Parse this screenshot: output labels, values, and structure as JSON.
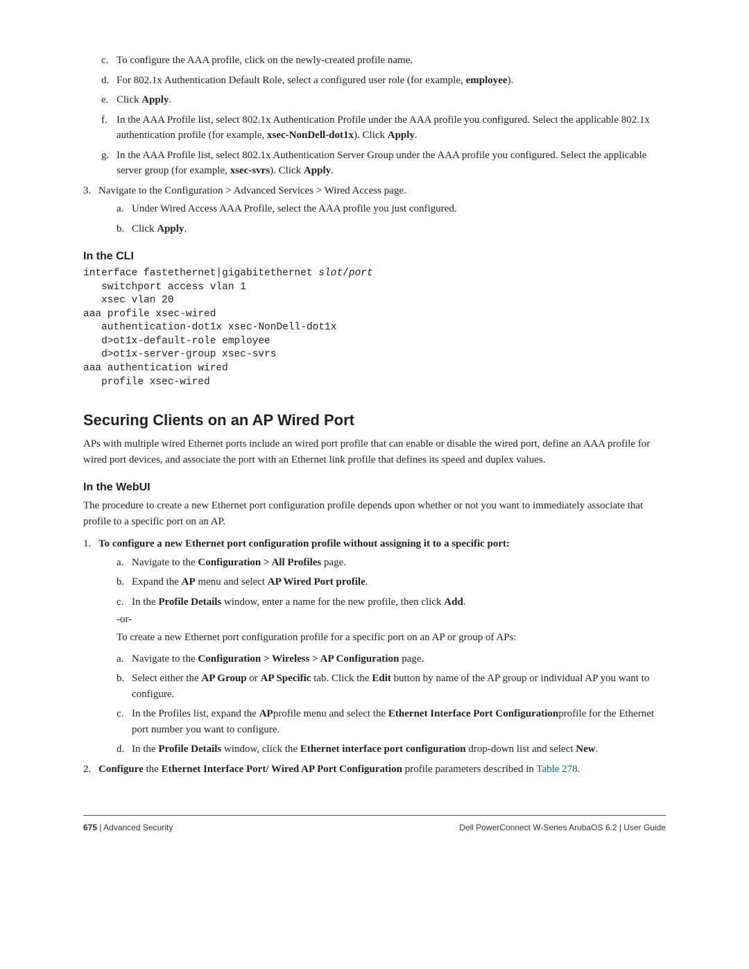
{
  "top_sub": {
    "c": "To configure the AAA profile, click on the newly-created profile name.",
    "d_pre": "For 802.1x Authentication Default Role, select a configured user role (for example, ",
    "d_bold": "employee",
    "d_post": ").",
    "e_pre": "Click ",
    "e_bold": "Apply",
    "e_post": ".",
    "f_pre": "In the AAA Profile list, select 802.1x Authentication Profile under the AAA profile you configured. Select the applicable 802.1x authentication profile (for example, ",
    "f_bold1": "xsec-NonDell-dot1x",
    "f_mid": "). Click ",
    "f_bold2": "Apply",
    "f_post": ".",
    "g_pre": "In the AAA Profile list, select 802.1x Authentication Server Group under the AAA profile you configured. Select the applicable server group (for example, ",
    "g_bold1": "xsec-svrs",
    "g_mid": "). Click ",
    "g_bold2": "Apply",
    "g_post": "."
  },
  "step3": {
    "text": "Navigate to the Configuration > Advanced Services > Wired Access page.",
    "a": "Under Wired Access AAA Profile, select the AAA profile you just configured.",
    "b_pre": "Click ",
    "b_bold": "Apply",
    "b_post": "."
  },
  "cli_heading": "In the CLI",
  "cli_code": {
    "l1a": "interface fastethernet|gigabitethernet ",
    "l1b": "slot",
    "l1c": "/",
    "l1d": "port",
    "l2": "   switchport access vlan 1",
    "l3": "   xsec vlan 20",
    "l4": "aaa profile xsec-wired",
    "l5": "   authentication-dot1x xsec-NonDell-dot1x",
    "l6": "   d>ot1x-default-role employee",
    "l7": "   d>ot1x-server-group xsec-svrs",
    "l8": "aaa authentication wired",
    "l9": "   profile xsec-wired"
  },
  "h2": "Securing Clients on an AP Wired Port",
  "h2_para": "APs with multiple wired Ethernet ports include an wired port profile that can enable or disable the wired port, define an AAA profile for wired port devices, and associate the port with an Ethernet link profile that defines its speed and duplex values.",
  "webui_heading": "In the WebUI",
  "webui_para": "The procedure to create a new Ethernet port configuration profile depends upon whether or not you want to immediately associate that profile to a specific port on an AP.",
  "step1": {
    "lead": "To configure a new Ethernet port configuration profile without assigning it to a specific port:",
    "a_pre": "Navigate to the ",
    "a_bold": "Configuration > All Profiles",
    "a_post": " page.",
    "b_pre": "Expand the ",
    "b_bold1": "AP",
    "b_mid": " menu and select ",
    "b_bold2": "AP Wired Port profile",
    "b_post": ".",
    "c_pre": "In the ",
    "c_bold1": "Profile Details",
    "c_mid": " window, enter a name for the new profile, then click ",
    "c_bold2": "Add",
    "c_post": "."
  },
  "or": "-or-",
  "alt_intro": "To create a new Ethernet port configuration profile for a specific port on an AP or group of APs:",
  "alt": {
    "a_pre": "Navigate to the ",
    "a_bold": "Configuration > Wireless > AP Configuration",
    "a_post": " page.",
    "b_pre": "Select either the ",
    "b_bold1": "AP Group",
    "b_mid1": " or ",
    "b_bold2": "AP Specific",
    "b_mid2": " tab. Click the ",
    "b_bold3": "Edit",
    "b_post": " button by name of the AP group or individual AP you want to configure.",
    "c_pre": "In the Profiles list, expand the ",
    "c_bold1": "AP",
    "c_mid1": "profile menu and select the ",
    "c_bold2": "Ethernet Interface Port Configuration",
    "c_post": "profile for the Ethernet port number you want to configure.",
    "d_pre": "In the ",
    "d_bold1": "Profile Details",
    "d_mid1": " window, click the ",
    "d_bold2": "Ethernet interface port configuration",
    "d_mid2": " drop-down list and select ",
    "d_bold3": "New",
    "d_post": "."
  },
  "step2": {
    "lead_bold1": "Configure",
    "lead_mid1": " the ",
    "lead_bold2": "Ethernet Interface Port/ Wired AP Port Configuration",
    "lead_mid2": " profile parameters described in ",
    "link": "Table 278",
    "post": "."
  },
  "footer": {
    "page_num": "675",
    "left_sep": " | ",
    "left_text": "Advanced Security",
    "right_product": "Dell PowerConnect W-Series ArubaOS 6.2",
    "right_sep": "  |  ",
    "right_doc": "User Guide"
  }
}
